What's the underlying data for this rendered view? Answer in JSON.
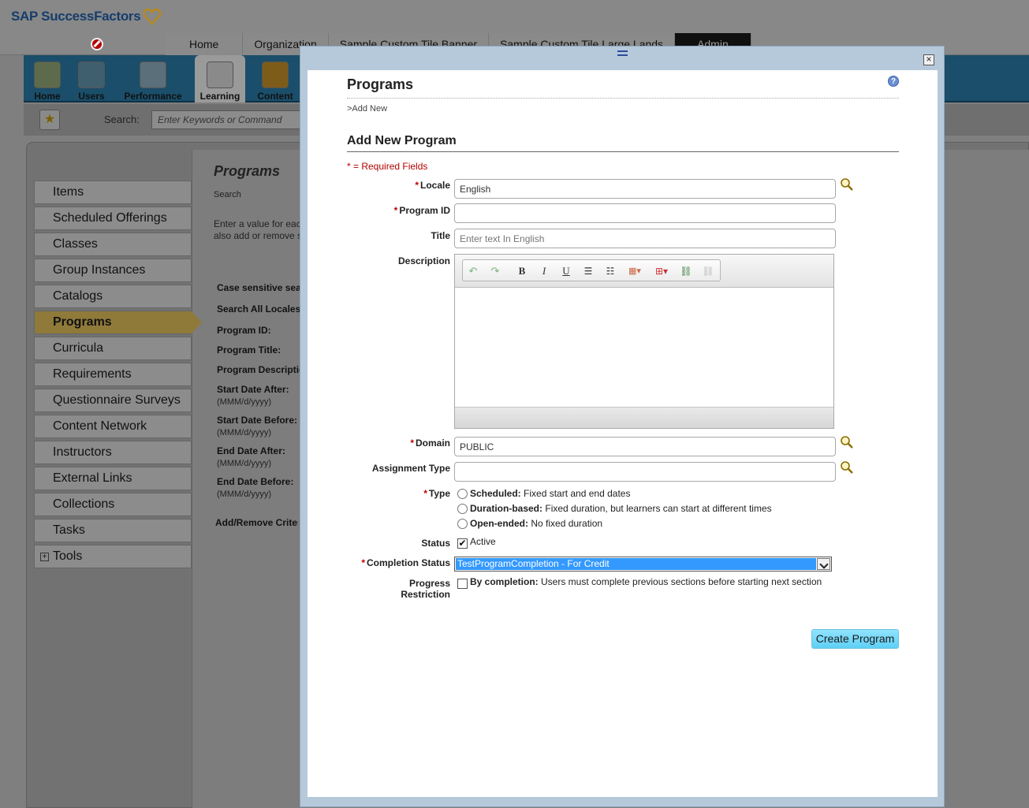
{
  "app": {
    "brand": "SAP SuccessFactors",
    "top_tabs": [
      "Home",
      "Organization",
      "Sample Custom Tile Banner",
      "Sample Custom Tile Large Lands",
      "Admin"
    ],
    "nav_items": [
      "Home",
      "Users",
      "Performance",
      "Learning",
      "Content"
    ],
    "search_label": "Search:",
    "search_placeholder": "Enter Keywords or Command"
  },
  "sidebar": {
    "items": [
      "Items",
      "Scheduled Offerings",
      "Classes",
      "Group Instances",
      "Catalogs",
      "Programs",
      "Curricula",
      "Requirements",
      "Questionnaire Surveys",
      "Content Network",
      "Instructors",
      "External Links",
      "Collections",
      "Tasks",
      "Tools"
    ],
    "selected": "Programs"
  },
  "background": {
    "title": "Programs",
    "subtitle": "Search",
    "hint_line1": "Enter a value for each",
    "hint_line2": "also add or remove se",
    "labels": [
      "Case sensitive sea",
      "Search All Locales:",
      "Program ID:",
      "Program Title:",
      "Program Descriptio",
      "Start Date After:",
      "Start Date Before:",
      "End Date After:",
      "End Date Before:",
      "Add/Remove Criter"
    ],
    "date_format": "(MMM/d/yyyy)"
  },
  "modal": {
    "title": "Programs",
    "breadcrumb": ">Add New",
    "section_title": "Add New Program",
    "required_note": "* = Required Fields",
    "fields": {
      "locale": {
        "label": "Locale",
        "value": "English"
      },
      "program_id": {
        "label": "Program ID",
        "value": ""
      },
      "title": {
        "label": "Title",
        "placeholder": "Enter text In English"
      },
      "description": {
        "label": "Description"
      },
      "domain": {
        "label": "Domain",
        "value": "PUBLIC"
      },
      "assignment_type": {
        "label": "Assignment Type",
        "value": ""
      },
      "type": {
        "label": "Type",
        "options": [
          {
            "name": "Scheduled:",
            "desc": "Fixed start and end dates"
          },
          {
            "name": "Duration-based:",
            "desc": "Fixed duration, but learners can start at different times"
          },
          {
            "name": "Open-ended:",
            "desc": "No fixed duration"
          }
        ]
      },
      "status": {
        "label": "Status",
        "option": "Active",
        "checked": true
      },
      "completion_status": {
        "label": "Completion Status",
        "value": "TestProgramCompletion - For Credit"
      },
      "progress_restriction": {
        "label_line1": "Progress",
        "label_line2": "Restriction",
        "option_name": "By completion:",
        "option_desc": "Users must complete previous sections before starting next section",
        "checked": false
      }
    },
    "submit_label": "Create Program"
  }
}
